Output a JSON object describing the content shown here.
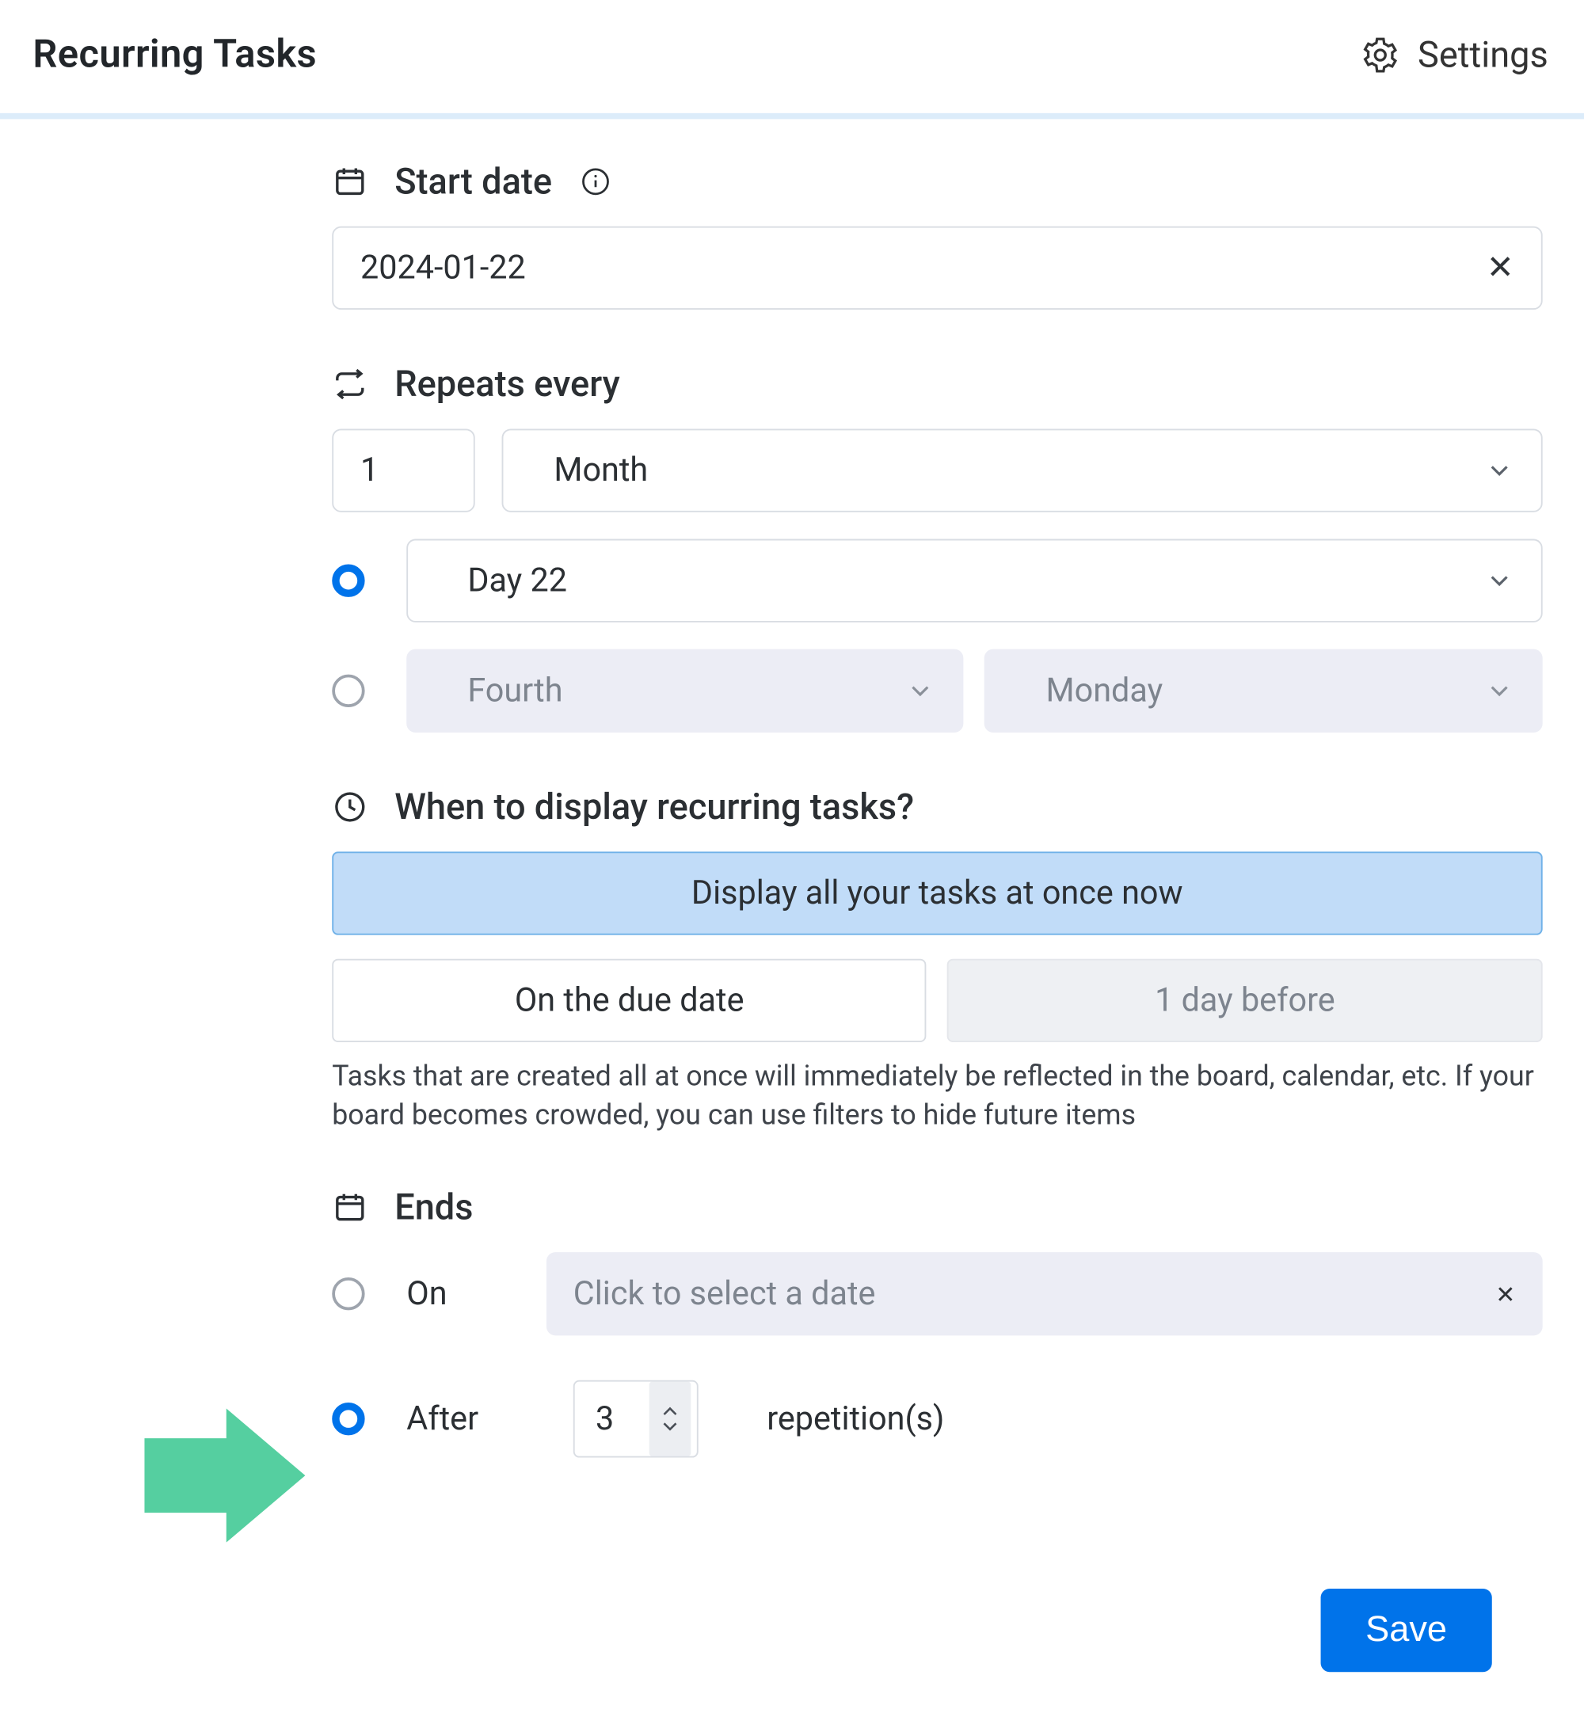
{
  "header": {
    "title": "Recurring Tasks",
    "settings_label": "Settings"
  },
  "start_date": {
    "label": "Start date",
    "value": "2024-01-22"
  },
  "repeats": {
    "label": "Repeats every",
    "interval": "1",
    "unit": "Month",
    "day_option_selected": true,
    "day_label": "Day 22",
    "ordinal_option_selected": false,
    "ordinal": "Fourth",
    "weekday": "Monday"
  },
  "display": {
    "label": "When to display recurring tasks?",
    "primary_option": "Display all your tasks at once now",
    "option_due_date": "On the due date",
    "option_before": "1 day before",
    "help": "Tasks that are created all at once will immediately be reflected in the board, calendar, etc. If your board becomes crowded, you can use filters to hide future items"
  },
  "ends": {
    "label": "Ends",
    "on_selected": false,
    "on_label": "On",
    "on_placeholder": "Click to select a date",
    "after_selected": true,
    "after_label": "After",
    "repetitions_value": "3",
    "repetitions_suffix": "repetition(s)"
  },
  "actions": {
    "save_label": "Save"
  },
  "colors": {
    "accent": "#0073ea",
    "highlight_bg": "#c1dcf8",
    "pointer_arrow": "#56cfa1"
  }
}
